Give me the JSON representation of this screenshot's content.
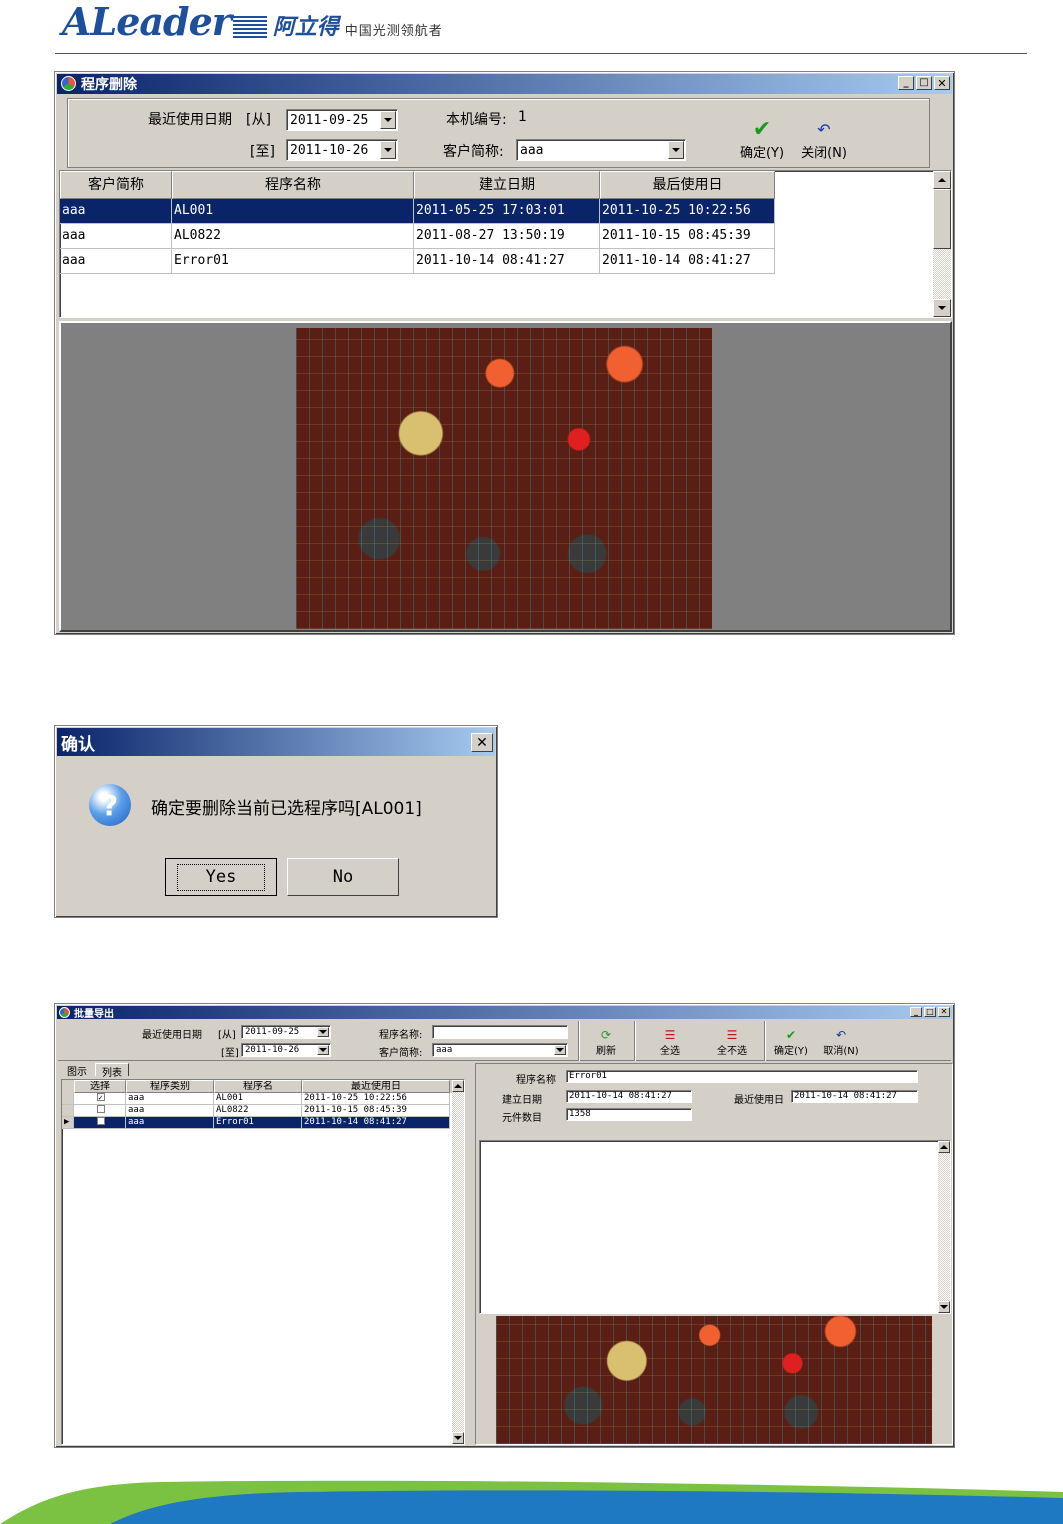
{
  "header": {
    "logo_text": "ALeader",
    "logo_cn": "阿立得",
    "tagline": "中国光测领航者"
  },
  "delete_window": {
    "title": "程序删除",
    "recent_date_label": "最近使用日期",
    "from_label": "[从]",
    "from_value": "2011-09-25",
    "to_label": "[至]",
    "to_value": "2011-10-26",
    "machine_no_label": "本机编号:",
    "machine_no_value": "1",
    "customer_label": "客户简称:",
    "customer_value": "aaa",
    "confirm_label": "确定(Y)",
    "close_label": "关闭(N)",
    "columns": [
      "客户简称",
      "程序名称",
      "建立日期",
      "最后使用日"
    ],
    "rows": [
      [
        "aaa",
        "AL001",
        "2011-05-25 17:03:01",
        "2011-10-25 10:22:56"
      ],
      [
        "aaa",
        "AL0822",
        "2011-08-27 13:50:19",
        "2011-10-15 08:45:39"
      ],
      [
        "aaa",
        "Error01",
        "2011-10-14 08:41:27",
        "2011-10-14 08:41:27"
      ]
    ],
    "selected_row": 0
  },
  "confirm_dialog": {
    "title": "确认",
    "message": "确定要删除当前已选程序吗[AL001]",
    "yes_label": "Yes",
    "no_label": "No"
  },
  "export_window": {
    "title": "批量导出",
    "recent_date_label": "最近使用日期",
    "from_label": "[从]",
    "from_value": "2011-09-25",
    "to_label": "[至]",
    "to_value": "2011-10-26",
    "program_name_label": "程序名称:",
    "program_name_value": "",
    "customer_label": "客户简称:",
    "customer_value": "aaa",
    "refresh_label": "刷新",
    "select_all_label": "全选",
    "select_none_label": "全不选",
    "confirm_label": "确定(Y)",
    "cancel_label": "取消(N)",
    "tabs": [
      "图示",
      "列表"
    ],
    "columns": [
      "选择",
      "程序类别",
      "程序名",
      "最近使用日"
    ],
    "rows": [
      {
        "checked": true,
        "category": "aaa",
        "name": "AL001",
        "date": "2011-10-25 10:22:56"
      },
      {
        "checked": false,
        "category": "aaa",
        "name": "AL0822",
        "date": "2011-10-15 08:45:39"
      },
      {
        "checked": false,
        "category": "aaa",
        "name": "Error01",
        "date": "2011-10-14 08:41:27"
      }
    ],
    "selected_row": 2,
    "detail": {
      "program_name_label": "程序名称",
      "program_name_value": "Error01",
      "created_label": "建立日期",
      "created_value": "2011-10-14 08:41:27",
      "last_used_label": "最近使用日",
      "last_used_value": "2011-10-14 08:41:27",
      "components_label": "元件数目",
      "components_value": "1358"
    }
  },
  "colors": {
    "brand_blue": "#1d4f9c",
    "selection": "#0a246a",
    "window_face": "#d4d0c8",
    "footer_green": "#7cc242",
    "footer_blue": "#1e78c2"
  }
}
